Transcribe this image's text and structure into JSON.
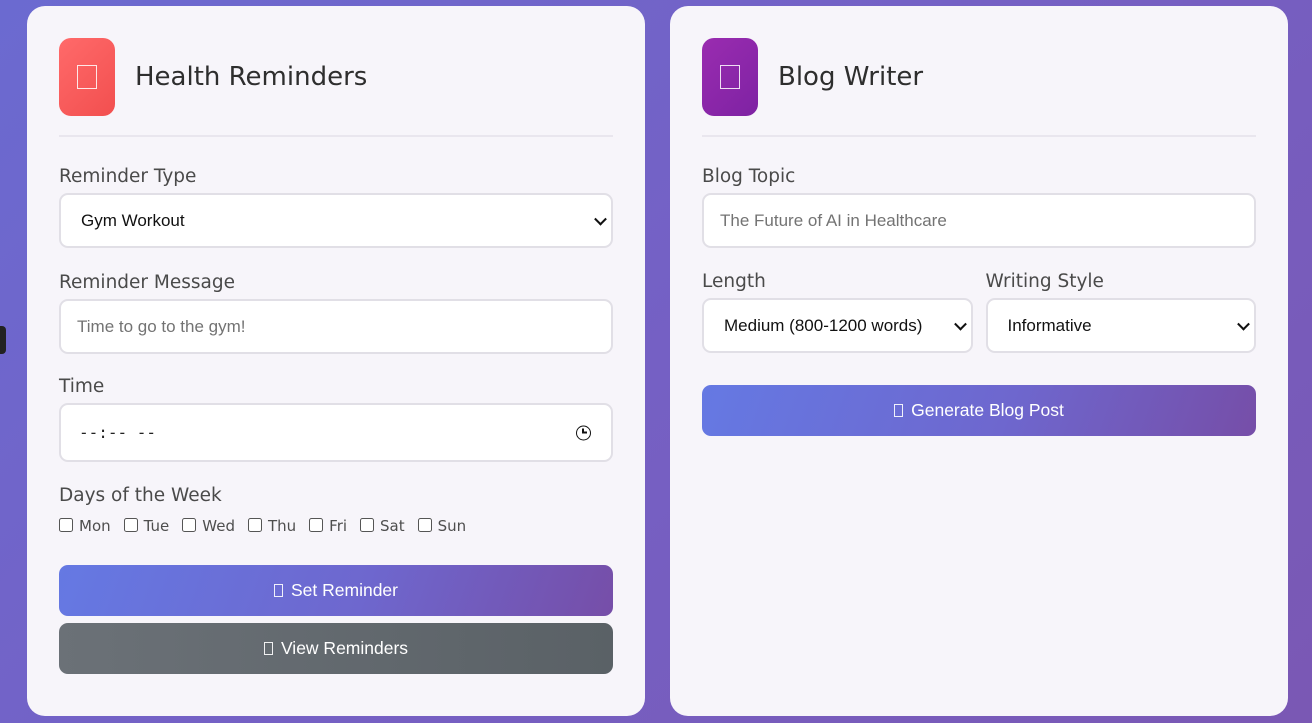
{
  "health": {
    "title": "Health Reminders",
    "icon": "heart-icon",
    "accent": "#ff5f5f",
    "reminder_type_label": "Reminder Type",
    "reminder_type_value": "Gym Workout",
    "message_label": "Reminder Message",
    "message_placeholder": "Time to go to the gym!",
    "time_label": "Time",
    "time_value": "--:-- --",
    "days_label": "Days of the Week",
    "days": [
      "Mon",
      "Tue",
      "Wed",
      "Thu",
      "Fri",
      "Sat",
      "Sun"
    ],
    "set_button": "Set Reminder",
    "view_button": "View Reminders"
  },
  "blog": {
    "title": "Blog Writer",
    "icon": "pen-icon",
    "accent": "#8e27ab",
    "topic_label": "Blog Topic",
    "topic_placeholder": "The Future of AI in Healthcare",
    "length_label": "Length",
    "length_value": "Medium (800-1200 words)",
    "style_label": "Writing Style",
    "style_value": "Informative",
    "generate_button": "Generate Blog Post"
  }
}
